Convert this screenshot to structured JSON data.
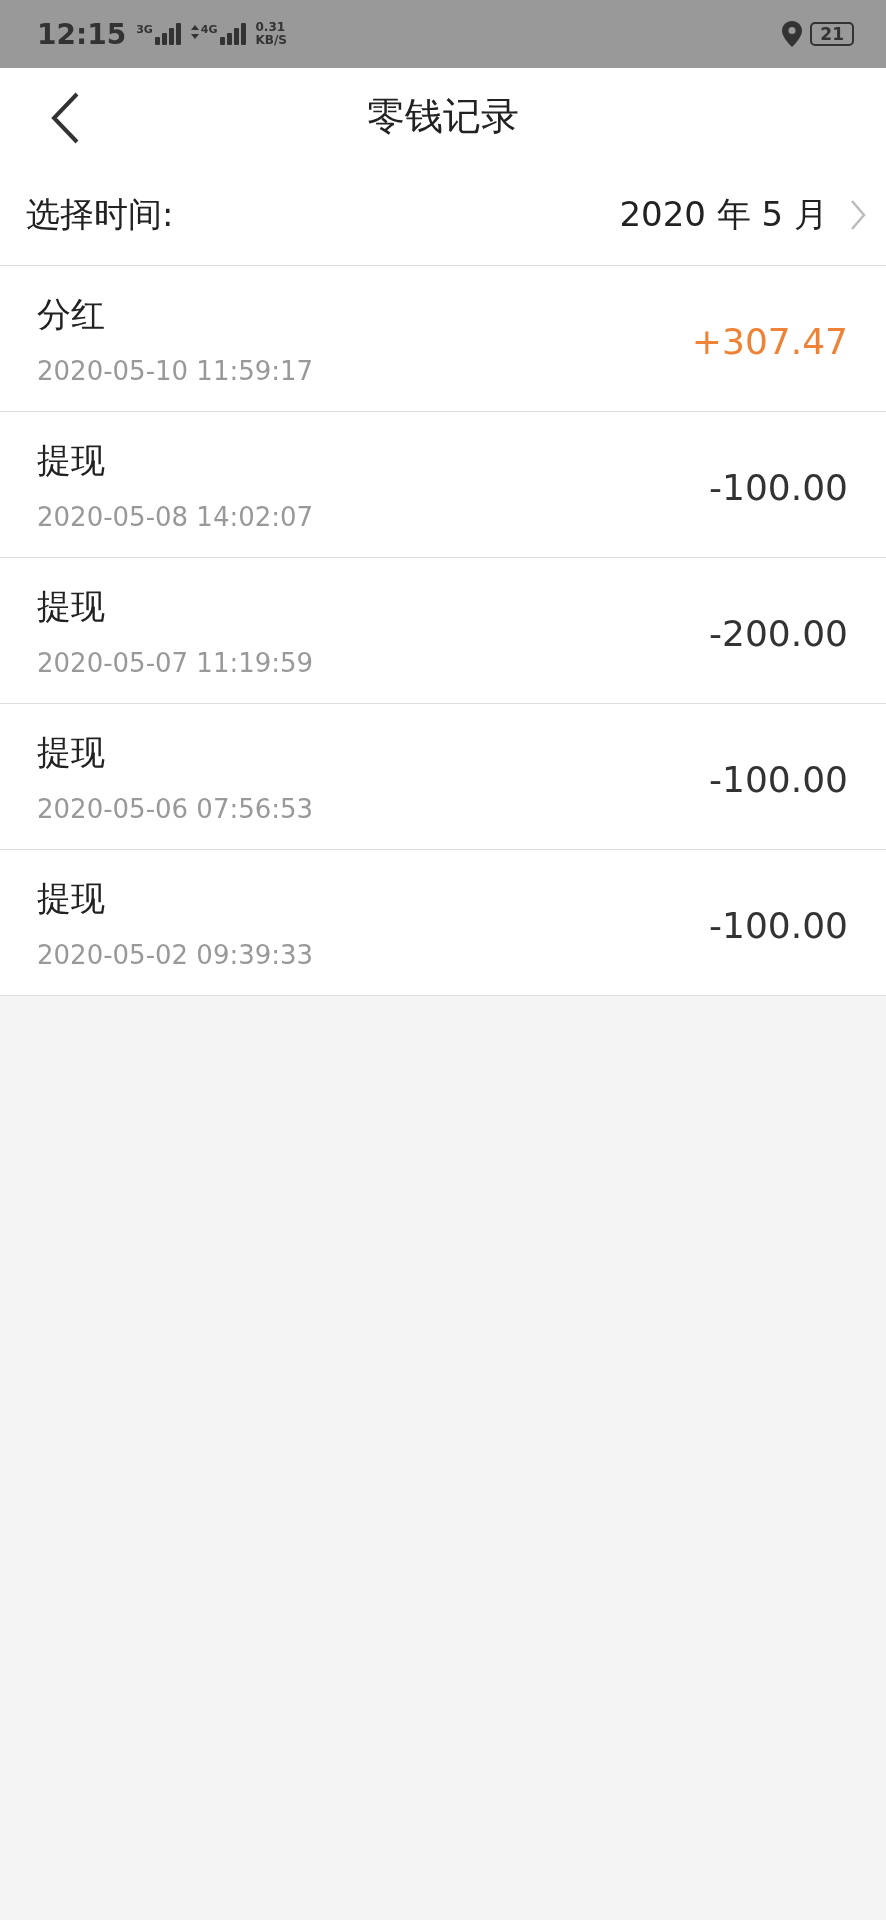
{
  "status_bar": {
    "time": "12:15",
    "sim1": "3G",
    "sim2": "4G",
    "speed": "0.31",
    "speed_unit": "KB/S",
    "battery": "21"
  },
  "header": {
    "title": "零钱记录"
  },
  "time_picker": {
    "label": "选择时间:",
    "value": "2020 年 5 月"
  },
  "records": [
    {
      "title": "分红",
      "time": "2020-05-10 11:59:17",
      "amount": "+307.47",
      "kind": "income"
    },
    {
      "title": "提现",
      "time": "2020-05-08 14:02:07",
      "amount": "-100.00",
      "kind": "expense"
    },
    {
      "title": "提现",
      "time": "2020-05-07 11:19:59",
      "amount": "-200.00",
      "kind": "expense"
    },
    {
      "title": "提现",
      "time": "2020-05-06 07:56:53",
      "amount": "-100.00",
      "kind": "expense"
    },
    {
      "title": "提现",
      "time": "2020-05-02 09:39:33",
      "amount": "-100.00",
      "kind": "expense"
    }
  ]
}
